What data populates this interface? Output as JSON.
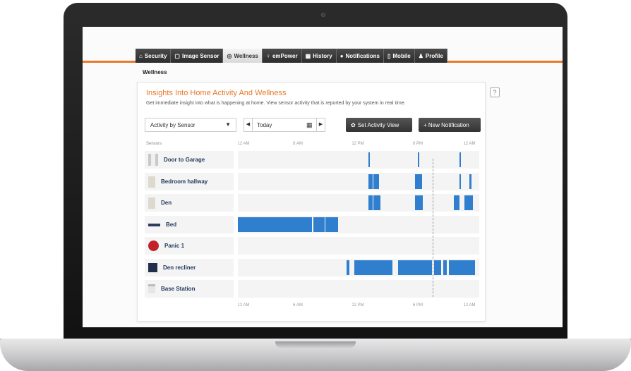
{
  "nav": {
    "tabs": [
      {
        "label": "Security",
        "icon": "home-icon"
      },
      {
        "label": "Image Sensor",
        "icon": "camera-icon"
      },
      {
        "label": "Wellness",
        "icon": "wellness-icon",
        "active": true
      },
      {
        "label": "emPower",
        "icon": "bulb-icon"
      },
      {
        "label": "History",
        "icon": "calendar-icon"
      },
      {
        "label": "Notifications",
        "icon": "chat-icon"
      },
      {
        "label": "Mobile",
        "icon": "phone-icon"
      },
      {
        "label": "Profile",
        "icon": "user-icon"
      }
    ]
  },
  "page": {
    "section": "Wellness",
    "help": "?",
    "title": "Insights Into Home Activity And Wellness",
    "subtitle": "Get immediate insight into what is happening at home. View sensor activity that is reported by your system in real time."
  },
  "controls": {
    "view_select": "Activity by Sensor",
    "date_value": "Today",
    "set_view_label": "Set Activity View",
    "new_notification_label": "+ New Notification"
  },
  "timeline": {
    "sensors_header": "Sensors",
    "axis_labels": [
      "12 AM",
      "6 AM",
      "12 PM",
      "6 PM",
      "12 AM"
    ],
    "now_hour": 19.4,
    "sensors": [
      {
        "name": "Door to Garage",
        "icon": "door-icon",
        "activity": [
          [
            13.0,
            13.15
          ],
          [
            17.9,
            18.05
          ],
          [
            22.0,
            22.15
          ]
        ]
      },
      {
        "name": "Bedroom hallway",
        "icon": "hallway-sensor-icon",
        "activity": [
          [
            13.0,
            13.4
          ],
          [
            13.5,
            14.0
          ],
          [
            17.6,
            18.3
          ],
          [
            22.0,
            22.2
          ],
          [
            23.0,
            23.2
          ]
        ]
      },
      {
        "name": "Den",
        "icon": "den-sensor-icon",
        "activity": [
          [
            13.0,
            13.4
          ],
          [
            13.5,
            14.2
          ],
          [
            17.6,
            18.4
          ],
          [
            21.5,
            22.0
          ],
          [
            22.5,
            23.4
          ]
        ]
      },
      {
        "name": "Bed",
        "icon": "bed-icon",
        "activity": [
          [
            0.0,
            7.4
          ],
          [
            7.5,
            8.6
          ],
          [
            8.7,
            10.0
          ]
        ]
      },
      {
        "name": "Panic 1",
        "icon": "panic-button-icon",
        "activity": []
      },
      {
        "name": "Den recliner",
        "icon": "recliner-icon",
        "activity": [
          [
            10.8,
            11.1
          ],
          [
            11.6,
            15.4
          ],
          [
            15.9,
            19.3
          ],
          [
            19.5,
            20.2
          ],
          [
            20.4,
            20.8
          ],
          [
            21.0,
            23.6
          ]
        ]
      },
      {
        "name": "Base Station",
        "icon": "base-station-icon",
        "activity": []
      }
    ]
  },
  "colors": {
    "accent": "#e8782a",
    "activity": "#2f7fce",
    "nav_dark": "#2d2d2d"
  }
}
